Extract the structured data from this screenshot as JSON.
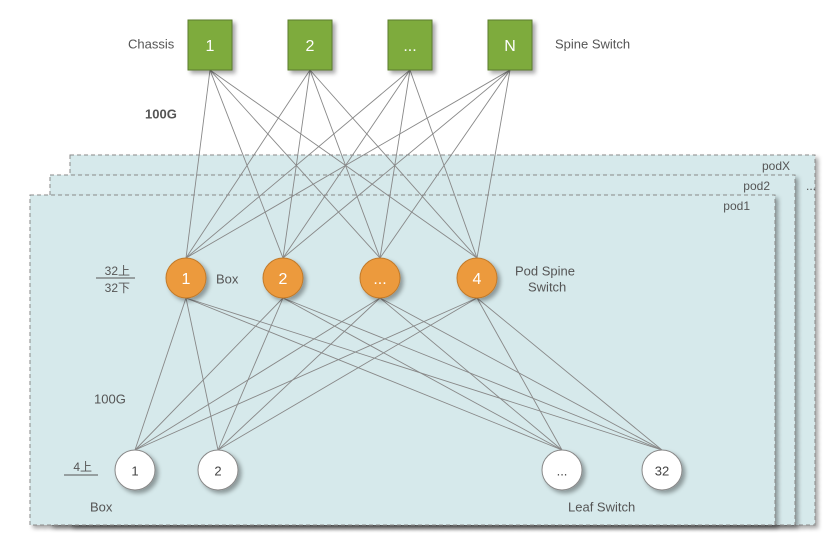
{
  "labels": {
    "chassis": "Chassis",
    "spine_switch": "Spine Switch",
    "link_100g_upper": "100G",
    "link_100g_lower": "100G",
    "pod_names": {
      "podX": "podX",
      "pod_ellipsis": "...",
      "pod2": "pod2",
      "pod1": "pod1"
    },
    "ports_up_32": "32上",
    "ports_down_32": "32下",
    "box_label_podspine": "Box",
    "pod_spine_switch": "Pod Spine\nSwitch",
    "ports_up_4": "4上",
    "box_label_leaf": "Box",
    "leaf_switch": "Leaf Switch"
  },
  "spine_switches": [
    {
      "label": "1"
    },
    {
      "label": "2"
    },
    {
      "label": "..."
    },
    {
      "label": "N"
    }
  ],
  "pod_spine_switches": [
    {
      "label": "1"
    },
    {
      "label": "2"
    },
    {
      "label": "..."
    },
    {
      "label": "4"
    }
  ],
  "leaf_switches": [
    {
      "label": "1"
    },
    {
      "label": "2"
    },
    {
      "label": "..."
    },
    {
      "label": "32"
    }
  ],
  "colors": {
    "spine_fill": "#7eab3d",
    "pod_spine_fill": "#ec9a3c",
    "leaf_fill": "#ffffff",
    "pod_bg": "#d6e9eb"
  }
}
